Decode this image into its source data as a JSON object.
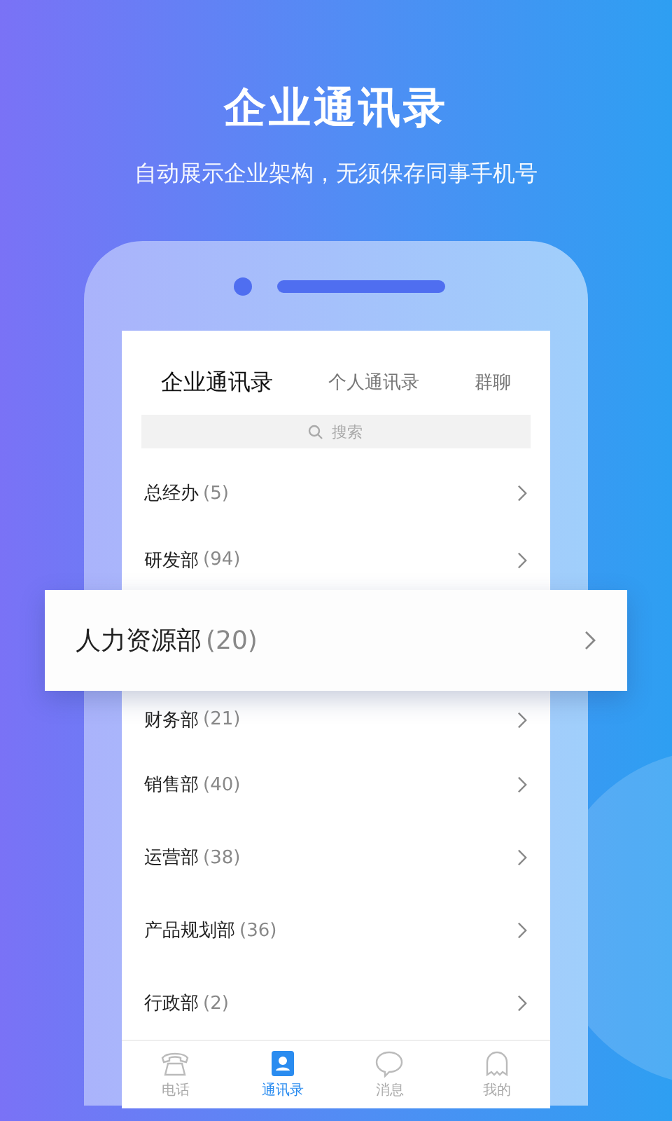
{
  "headline": "企业通讯录",
  "subtitle": "自动展示企业架构，无须保存同事手机号",
  "tabs": [
    {
      "label": "企业通讯录",
      "selected": true
    },
    {
      "label": "个人通讯录",
      "selected": false
    },
    {
      "label": "群聊",
      "selected": false
    }
  ],
  "search": {
    "placeholder": "搜索"
  },
  "departments": [
    {
      "name": "总经办",
      "count": "(5)",
      "highlighted": false
    },
    {
      "name": "研发部",
      "count": "(94)",
      "highlighted": false
    },
    {
      "name": "人力资源部",
      "count": "(20)",
      "highlighted": true
    },
    {
      "name": "财务部",
      "count": "(21)",
      "highlighted": false
    },
    {
      "name": "销售部",
      "count": "(40)",
      "highlighted": false
    },
    {
      "name": "运营部",
      "count": "(38)",
      "highlighted": false
    },
    {
      "name": "产品规划部",
      "count": "(36)",
      "highlighted": false
    },
    {
      "name": "行政部",
      "count": "(2)",
      "highlighted": false
    }
  ],
  "tab_bar": [
    {
      "kind": "phone",
      "label": "电话",
      "selected": false
    },
    {
      "kind": "contacts",
      "label": "通讯录",
      "selected": true
    },
    {
      "kind": "message",
      "label": "消息",
      "selected": false
    },
    {
      "kind": "me",
      "label": "我的",
      "selected": false
    }
  ]
}
